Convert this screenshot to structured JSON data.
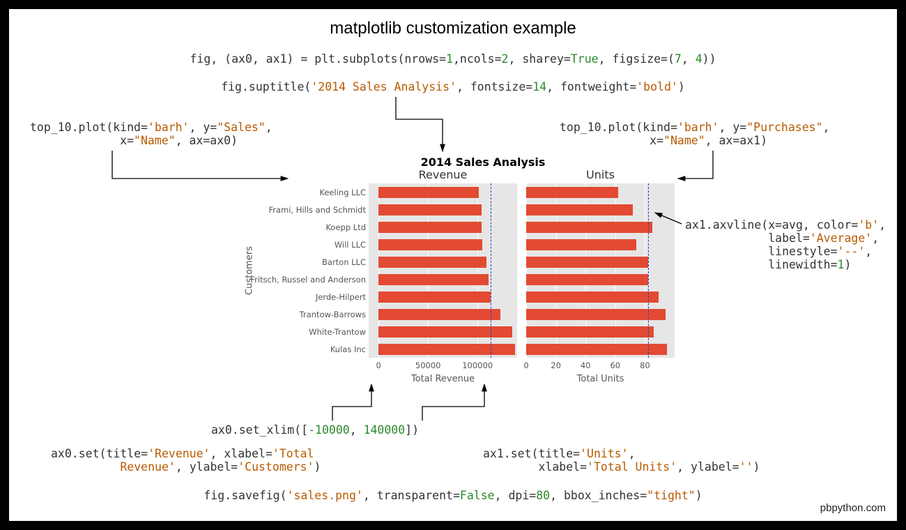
{
  "title": "matplotlib customization example",
  "attribution": "pbpython.com",
  "code": {
    "subplots": "fig, (ax0, ax1) = plt.subplots(nrows=1,ncols=2, sharey=True, figsize=(7, 4))",
    "suptitle": "fig.suptitle('2014 Sales Analysis', fontsize=14, fontweight='bold')",
    "plot0": "top_10.plot(kind='barh', y=\"Sales\",\n             x=\"Name\", ax=ax0)",
    "plot1": "top_10.plot(kind='barh', y=\"Purchases\",\n             x=\"Name\", ax=ax1)",
    "axvline": "ax1.axvline(x=avg, color='b',\n            label='Average',\n            linestyle='--',\n            linewidth=1)",
    "xlim": "ax0.set_xlim([-10000, 140000])",
    "ax0set": "ax0.set(title='Revenue', xlabel='Total\n          Revenue', ylabel='Customers')",
    "ax1set": "ax1.set(title='Units',\n        xlabel='Total Units', ylabel='')",
    "savefig": "fig.savefig('sales.png', transparent=False, dpi=80, bbox_inches=\"tight\")"
  },
  "figure": {
    "suptitle": "2014 Sales Analysis",
    "ax0": {
      "title": "Revenue",
      "xlabel": "Total Revenue",
      "ylabel": "Customers"
    },
    "ax1": {
      "title": "Units",
      "xlabel": "Total Units",
      "ylabel": ""
    }
  },
  "chart_data": [
    {
      "type": "bar",
      "orientation": "horizontal",
      "title": "Revenue",
      "xlabel": "Total Revenue",
      "ylabel": "Customers",
      "xlim": [
        -10000,
        140000
      ],
      "xticks": [
        0,
        50000,
        100000
      ],
      "avg_line": 113000,
      "categories": [
        "Keeling LLC",
        "Frami, Hills and Schmidt",
        "Koepp Ltd",
        "Will LLC",
        "Barton LLC",
        "Fritsch, Russel and Anderson",
        "Jerde-Hilpert",
        "Trantow-Barrows",
        "White-Trantow",
        "Kulas Inc"
      ],
      "values": [
        101000,
        104000,
        104000,
        105000,
        109000,
        111000,
        113000,
        123000,
        135000,
        138000
      ]
    },
    {
      "type": "bar",
      "orientation": "horizontal",
      "title": "Units",
      "xlabel": "Total Units",
      "ylabel": "",
      "xlim": [
        0,
        100
      ],
      "xticks": [
        0,
        20,
        40,
        60,
        80
      ],
      "avg_line": 82,
      "categories": [
        "Keeling LLC",
        "Frami, Hills and Schmidt",
        "Koepp Ltd",
        "Will LLC",
        "Barton LLC",
        "Fritsch, Russel and Anderson",
        "Jerde-Hilpert",
        "Trantow-Barrows",
        "White-Trantow",
        "Kulas Inc"
      ],
      "values": [
        62,
        72,
        85,
        74,
        82,
        82,
        89,
        94,
        86,
        95
      ]
    }
  ]
}
